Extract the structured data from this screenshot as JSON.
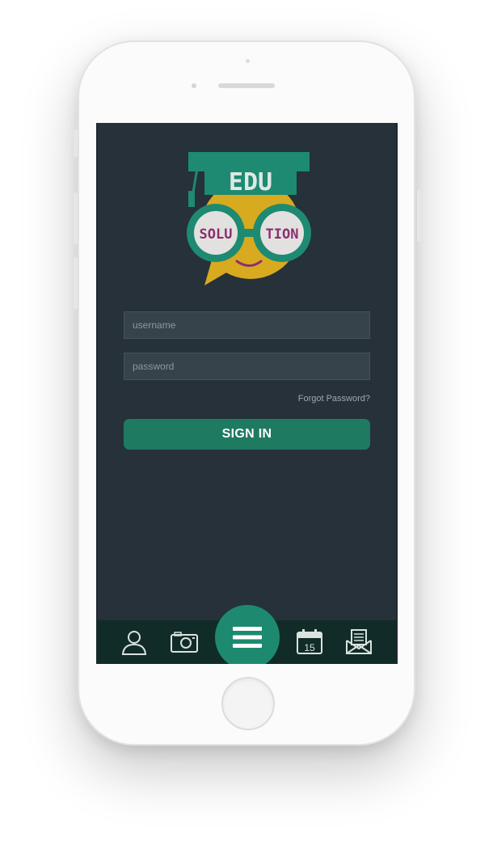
{
  "app": {
    "logo_text": {
      "line1": "EDU",
      "left_lens": "SOLU",
      "right_lens": "TION"
    }
  },
  "login": {
    "username_placeholder": "username",
    "password_placeholder": "password",
    "forgot_label": "Forgot Password?",
    "signin_label": "SIGN IN"
  },
  "tabbar": {
    "items": [
      {
        "icon": "user-icon"
      },
      {
        "icon": "camera-icon"
      },
      {
        "icon": "menu-icon"
      },
      {
        "icon": "calendar-icon",
        "day": "15"
      },
      {
        "icon": "mail-icon"
      }
    ]
  },
  "colors": {
    "screen_bg": "#263139",
    "accent": "#1f7a62",
    "fab": "#1d8a6f",
    "tabbar_bg": "#112c28",
    "logo_teal": "#1e8a71",
    "logo_yellow": "#d7aa1f",
    "logo_purple": "#8a2f6e"
  }
}
